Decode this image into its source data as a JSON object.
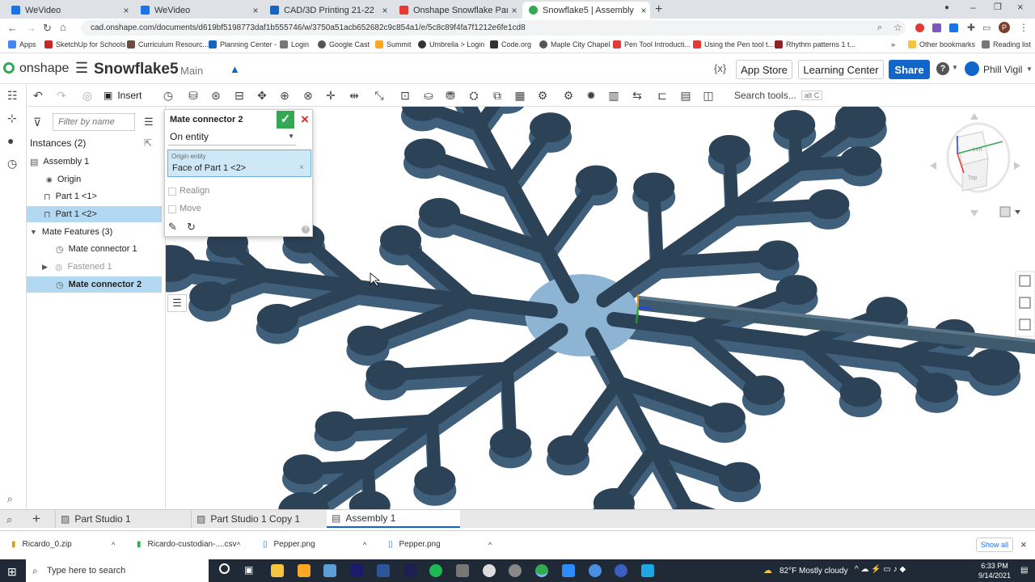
{
  "browser": {
    "tabs": [
      {
        "title": "WeVideo",
        "color": "#1a73e8"
      },
      {
        "title": "WeVideo",
        "color": "#1a73e8"
      },
      {
        "title": "CAD/3D Printing 21-22",
        "color": "#1565c0"
      },
      {
        "title": "Onshape Snowflake Part 2 - YouT",
        "color": "#e53935"
      },
      {
        "title": "Snowflake5 | Assembly 1",
        "color": "#35a853",
        "active": true
      }
    ],
    "url": "cad.onshape.com/documents/d619bf5198773daf1b555746/w/3750a51acb652682c9c854a1/e/5c8c89f4fa7f1212e6fe1cd8",
    "bookmarks": [
      "Apps",
      "SketchUp for Schools",
      "Curriculum Resourc...",
      "Planning Center -",
      "Login",
      "Google Cast",
      "Summit",
      "Umbrella > Login",
      "Code.org",
      "Maple City Chapel",
      "Pen Tool Introducti...",
      "Using the Pen tool t...",
      "Rhythm patterns 1 t..."
    ],
    "other_bookmarks": "Other bookmarks",
    "reading_list": "Reading list"
  },
  "header": {
    "logo": "onshape",
    "doc_title": "Snowflake5",
    "branch": "Main",
    "app_store": "App Store",
    "learning_center": "Learning Center",
    "share": "Share",
    "user": "Phill Vigil",
    "search_tools": "Search tools...",
    "search_shortcut": "alt C",
    "insert": "Insert"
  },
  "tree": {
    "filter_placeholder": "Filter by name",
    "instances_label": "Instances (2)",
    "assembly": "Assembly 1",
    "origin": "Origin",
    "part1": "Part 1 <1>",
    "part2": "Part 1 <2>",
    "mate_features": "Mate Features (3)",
    "mc1": "Mate connector 1",
    "fastened": "Fastened 1",
    "mc2": "Mate connector 2"
  },
  "dialog": {
    "title": "Mate connector 2",
    "mode": "On entity",
    "origin_label": "Origin entity",
    "origin_value": "Face of Part 1 <2>",
    "realign": "Realign",
    "move": "Move"
  },
  "bottom_tabs": [
    "Part Studio 1",
    "Part Studio 1 Copy 1",
    "Assembly 1"
  ],
  "downloads": [
    "Ricardo_0.zip",
    "Ricardo-custodian-....csv",
    "Pepper.png",
    "Pepper.png"
  ],
  "show_all": "Show all",
  "taskbar": {
    "search": "Type here to search",
    "weather": "82°F  Mostly cloudy",
    "time": "6:33 PM",
    "date": "9/14/2021"
  },
  "colors": {
    "snowflake_top": "#8db4d3",
    "snowflake_side": "#3f5f7a",
    "accent": "#1266c9",
    "selection": "#b3d9f2"
  }
}
